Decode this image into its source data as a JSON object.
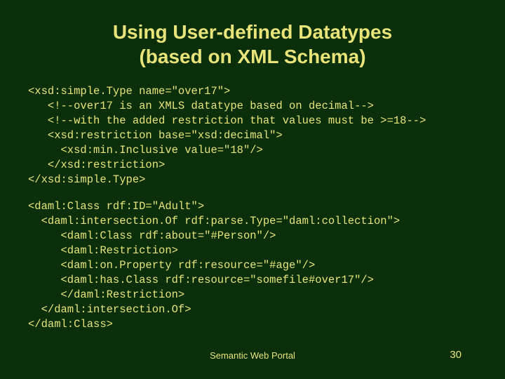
{
  "slide": {
    "title_line1": "Using User-defined Datatypes",
    "title_line2": "(based on XML Schema)",
    "code_block1": "<xsd:simple.Type name=\"over17\">\n   <!--over17 is an XMLS datatype based on decimal-->\n   <!--with the added restriction that values must be >=18-->\n   <xsd:restriction base=\"xsd:decimal\">\n     <xsd:min.Inclusive value=\"18\"/>\n   </xsd:restriction>\n</xsd:simple.Type>",
    "code_block2": "<daml:Class rdf:ID=\"Adult\">\n  <daml:intersection.Of rdf:parse.Type=\"daml:collection\">\n     <daml:Class rdf:about=\"#Person\"/>\n     <daml:Restriction>\n     <daml:on.Property rdf:resource=\"#age\"/>\n     <daml:has.Class rdf:resource=\"somefile#over17\"/>\n     </daml:Restriction>\n  </daml:intersection.Of>\n</daml:Class>",
    "footer": "Semantic Web Portal",
    "page_number": "30"
  }
}
